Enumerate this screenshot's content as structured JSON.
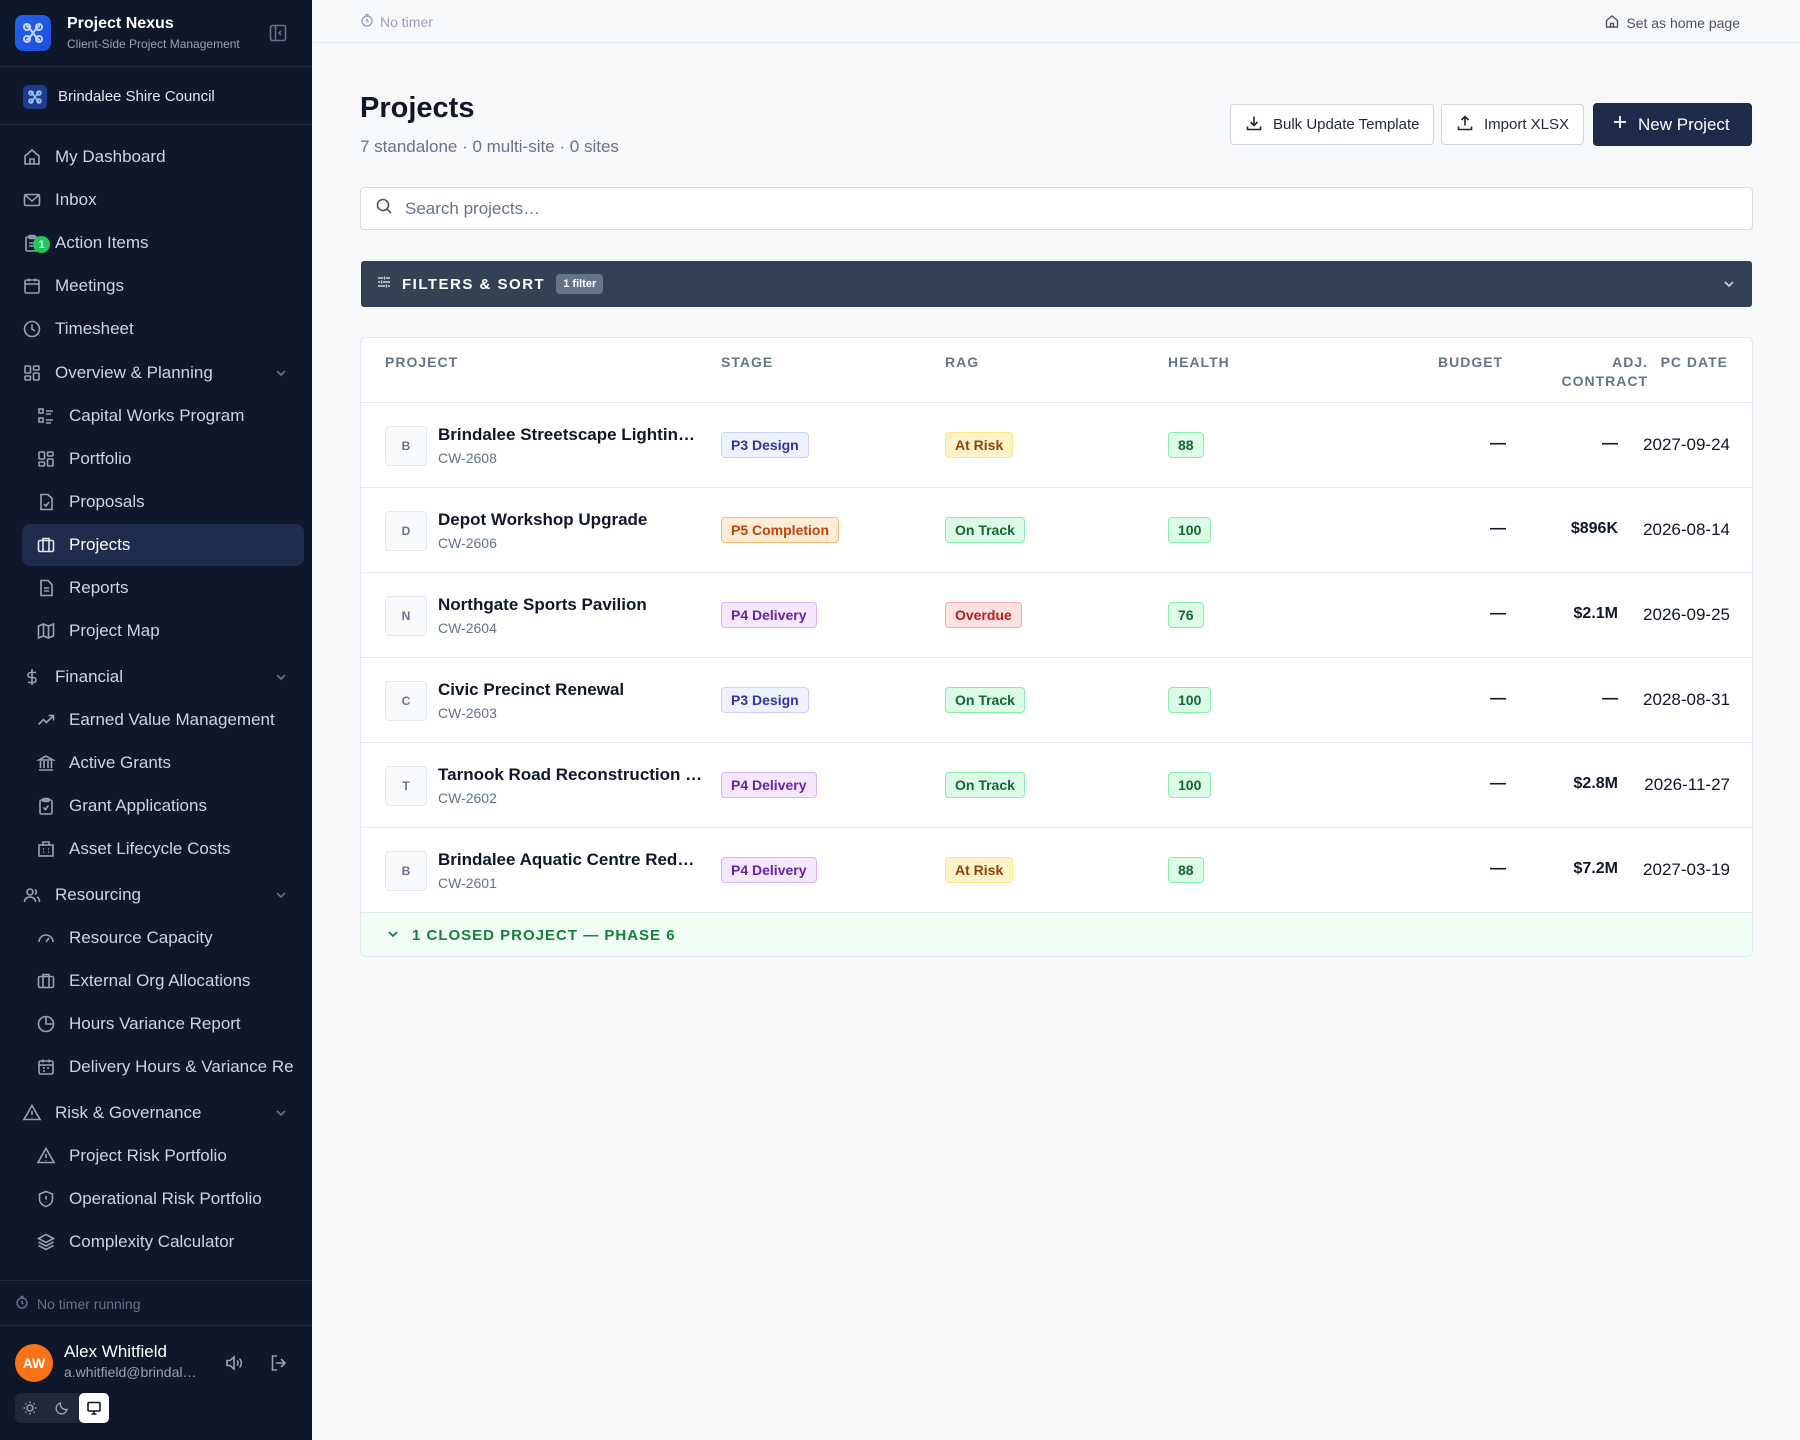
{
  "app": {
    "title": "Project Nexus",
    "subtitle": "Client-Side Project Management"
  },
  "org": {
    "name": "Brindalee Shire Council"
  },
  "sidebar": {
    "items": [
      {
        "label": "My Dashboard",
        "icon": "home-icon"
      },
      {
        "label": "Inbox",
        "icon": "mail-icon"
      },
      {
        "label": "Action Items",
        "icon": "clipboard-icon",
        "badge": "1"
      },
      {
        "label": "Meetings",
        "icon": "calendar-icon"
      },
      {
        "label": "Timesheet",
        "icon": "clock-icon"
      },
      {
        "label": "Overview & Planning",
        "icon": "grid-icon"
      },
      {
        "label": "Capital Works Program",
        "icon": "list-icon"
      },
      {
        "label": "Portfolio",
        "icon": "grid-icon"
      },
      {
        "label": "Proposals",
        "icon": "file-check-icon"
      },
      {
        "label": "Projects",
        "icon": "briefcase-icon"
      },
      {
        "label": "Reports",
        "icon": "file-text-icon"
      },
      {
        "label": "Project Map",
        "icon": "map-icon"
      },
      {
        "label": "Financial",
        "icon": "dollar-icon"
      },
      {
        "label": "Earned Value Management",
        "icon": "trending-up-icon"
      },
      {
        "label": "Active Grants",
        "icon": "landmark-icon"
      },
      {
        "label": "Grant Applications",
        "icon": "clipboard-icon"
      },
      {
        "label": "Asset Lifecycle Costs",
        "icon": "building-icon"
      },
      {
        "label": "Resourcing",
        "icon": "users-icon"
      },
      {
        "label": "Resource Capacity",
        "icon": "gauge-icon"
      },
      {
        "label": "External Org Allocations",
        "icon": "building-icon"
      },
      {
        "label": "Hours Variance Report",
        "icon": "pie-icon"
      },
      {
        "label": "Delivery Hours & Variance Re",
        "icon": "calendar-icon"
      },
      {
        "label": "Risk & Governance",
        "icon": "alert-icon"
      },
      {
        "label": "Project Risk Portfolio",
        "icon": "alert-icon"
      },
      {
        "label": "Operational Risk Portfolio",
        "icon": "shield-icon"
      },
      {
        "label": "Complexity Calculator",
        "icon": "layers-icon"
      }
    ],
    "timer": "No timer running",
    "user": {
      "initials": "AW",
      "name": "Alex Whitfield",
      "email": "a.whitfield@brindal…"
    }
  },
  "topbar": {
    "timer": "No timer",
    "home": "Set as home page"
  },
  "page": {
    "title": "Projects",
    "subtitle": "7 standalone · 0 multi-site · 0 sites",
    "buttons": {
      "bulk": "Bulk Update Template",
      "import": "Import XLSX",
      "new": "New Project"
    },
    "search_placeholder": "Search projects…",
    "filters": {
      "label": "FILTERS & SORT",
      "badge": "1 filter"
    }
  },
  "table": {
    "headers": {
      "project": "PROJECT",
      "stage": "STAGE",
      "rag": "RAG",
      "health": "HEALTH",
      "budget": "BUDGET",
      "adj1": "ADJ.",
      "adj2": "CONTRACT",
      "pcdate": "PC DATE"
    },
    "rows": [
      {
        "initial": "B",
        "name": "Brindalee Streetscape Lightin…",
        "code": "CW-2608",
        "stage": "P3 Design",
        "rag": "At Risk",
        "health": "88",
        "budget": "—",
        "contract": "—",
        "date": "2027-09-24"
      },
      {
        "initial": "D",
        "name": "Depot Workshop Upgrade",
        "code": "CW-2606",
        "stage": "P5 Completion",
        "rag": "On Track",
        "health": "100",
        "budget": "—",
        "contract": "$896K",
        "date": "2026-08-14"
      },
      {
        "initial": "N",
        "name": "Northgate Sports Pavilion",
        "code": "CW-2604",
        "stage": "P4 Delivery",
        "rag": "Overdue",
        "health": "76",
        "budget": "—",
        "contract": "$2.1M",
        "date": "2026-09-25"
      },
      {
        "initial": "C",
        "name": "Civic Precinct Renewal",
        "code": "CW-2603",
        "stage": "P3 Design",
        "rag": "On Track",
        "health": "100",
        "budget": "—",
        "contract": "—",
        "date": "2028-08-31"
      },
      {
        "initial": "T",
        "name": "Tarnook Road Reconstruction …",
        "code": "CW-2602",
        "stage": "P4 Delivery",
        "rag": "On Track",
        "health": "100",
        "budget": "—",
        "contract": "$2.8M",
        "date": "2026-11-27"
      },
      {
        "initial": "B",
        "name": "Brindalee Aquatic Centre Rede…",
        "code": "CW-2601",
        "stage": "P4 Delivery",
        "rag": "At Risk",
        "health": "88",
        "budget": "—",
        "contract": "$7.2M",
        "date": "2027-03-19"
      }
    ],
    "closed": "1 CLOSED PROJECT — PHASE 6"
  },
  "colors": {
    "sidebar_bg": "#0f172a",
    "active_item": "#1e2d4d",
    "primary_button": "#1e2a4a",
    "filters_bar": "#334155",
    "stage_p3": "#eef2ff",
    "stage_p4": "#f3e8ff",
    "stage_p5": "#ffedd5",
    "rag_at_risk": "#fef3c7",
    "rag_on_track": "#dcfce7",
    "rag_overdue": "#fee2e2",
    "health": "#dcfce7",
    "closed_text": "#15803d"
  }
}
